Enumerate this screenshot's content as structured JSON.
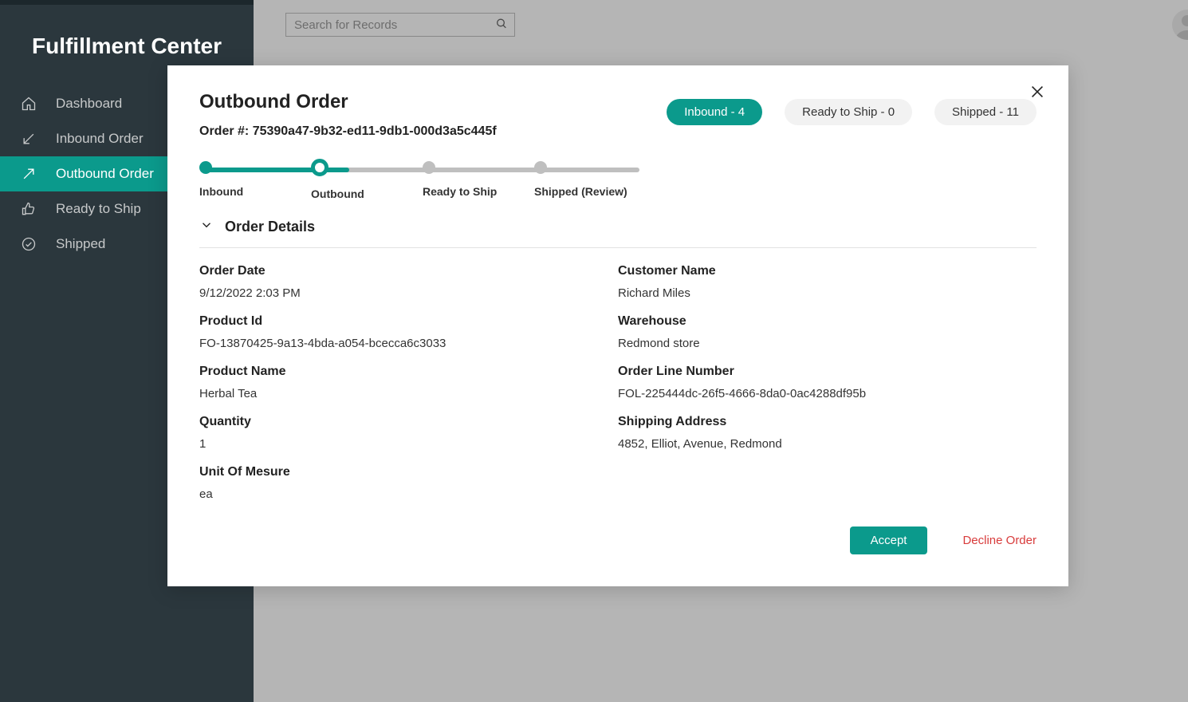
{
  "app": {
    "title": "Fulfillment Center"
  },
  "search": {
    "placeholder": "Search for Records"
  },
  "sidebar": {
    "items": [
      {
        "label": "Dashboard",
        "icon": "home-icon"
      },
      {
        "label": "Inbound Order",
        "icon": "arrow-down-left-icon"
      },
      {
        "label": "Outbound Order",
        "icon": "arrow-up-right-icon"
      },
      {
        "label": "Ready to Ship",
        "icon": "thumbs-up-icon"
      },
      {
        "label": "Shipped",
        "icon": "check-circle-icon"
      }
    ],
    "activeIndex": 2
  },
  "modal": {
    "title": "Outbound Order",
    "orderNumberLabel": "Order #: 75390a47-9b32-ed11-9db1-000d3a5c445f",
    "pills": [
      {
        "label": "Inbound - 4",
        "accent": true
      },
      {
        "label": "Ready to Ship - 0",
        "accent": false
      },
      {
        "label": "Shipped - 11",
        "accent": false
      }
    ],
    "steps": [
      {
        "label": "Inbound",
        "state": "done"
      },
      {
        "label": "Outbound",
        "state": "current"
      },
      {
        "label": "Ready to Ship",
        "state": "pending"
      },
      {
        "label": "Shipped (Review)",
        "state": "pending"
      }
    ],
    "sectionTitle": "Order Details",
    "details": {
      "left": [
        {
          "label": "Order Date",
          "value": "9/12/2022 2:03 PM"
        },
        {
          "label": "Product Id",
          "value": "FO-13870425-9a13-4bda-a054-bcecca6c3033"
        },
        {
          "label": "Product Name",
          "value": "Herbal Tea"
        },
        {
          "label": "Quantity",
          "value": "1"
        },
        {
          "label": "Unit Of Mesure",
          "value": "ea"
        }
      ],
      "right": [
        {
          "label": "Customer Name",
          "value": "Richard Miles"
        },
        {
          "label": "Warehouse",
          "value": "Redmond store"
        },
        {
          "label": "Order Line Number",
          "value": "FOL-225444dc-26f5-4666-8da0-0ac4288df95b"
        },
        {
          "label": "Shipping Address",
          "value": "4852, Elliot, Avenue, Redmond"
        }
      ]
    },
    "actions": {
      "accept": "Accept",
      "decline": "Decline Order"
    }
  }
}
